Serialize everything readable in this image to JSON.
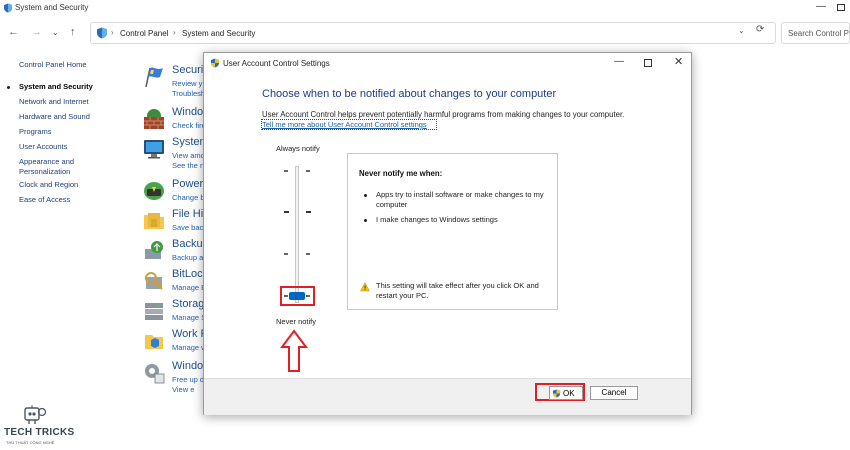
{
  "window": {
    "title": "System and Security"
  },
  "address": {
    "crumbs": [
      "Control Panel",
      "System and Security"
    ],
    "search_placeholder": "Search Control Panel"
  },
  "sidebar": {
    "items": [
      {
        "label": "Control Panel Home"
      },
      {
        "label": "System and Security",
        "current": true
      },
      {
        "label": "Network and Internet"
      },
      {
        "label": "Hardware and Sound"
      },
      {
        "label": "Programs"
      },
      {
        "label": "User Accounts"
      },
      {
        "label": "Appearance and"
      },
      {
        "label": "Personalization"
      },
      {
        "label": "Clock and Region"
      },
      {
        "label": "Ease of Access"
      }
    ]
  },
  "categories": [
    {
      "name": "Securit",
      "links": [
        "Review y",
        "Troublesh"
      ],
      "icon": "flag-icon"
    },
    {
      "name": "Window",
      "links": [
        "Check fire"
      ],
      "icon": "firewall-icon"
    },
    {
      "name": "System",
      "links": [
        "View amo",
        "See the n"
      ],
      "icon": "monitor-icon"
    },
    {
      "name": "Power O",
      "links": [
        "Change b"
      ],
      "icon": "power-icon"
    },
    {
      "name": "File His",
      "links": [
        "Save back"
      ],
      "icon": "folder-icon"
    },
    {
      "name": "Backup",
      "links": [
        "Backup a"
      ],
      "icon": "backup-icon"
    },
    {
      "name": "BitLock",
      "links": [
        "Manage B"
      ],
      "icon": "key-icon"
    },
    {
      "name": "Storage",
      "links": [
        "Manage S"
      ],
      "icon": "storage-icon"
    },
    {
      "name": "Work F",
      "links": [
        "Manage w"
      ],
      "icon": "work-folders-icon"
    },
    {
      "name": "Window",
      "links": [
        "Free up d",
        "View e"
      ],
      "icon": "tools-icon"
    }
  ],
  "dialog": {
    "title": "User Account Control Settings",
    "heading": "Choose when to be notified about changes to your computer",
    "description": "User Account Control helps prevent potentially harmful programs from making changes to your computer.",
    "learn_link": "Tell me more about User Account Control settings",
    "slider": {
      "top_label": "Always notify",
      "bottom_label": "Never notify",
      "level": 1,
      "levels": 4
    },
    "info": {
      "title": "Never notify me when:",
      "bullets": [
        "Apps try to install software or make changes to my computer",
        "I make changes to Windows settings"
      ],
      "warning": "This setting will take effect after you click OK and restart your PC."
    },
    "buttons": {
      "ok": "OK",
      "cancel": "Cancel"
    },
    "highlight_color": "#e31e24"
  },
  "watermark": {
    "name": "TECH TRICKS",
    "tagline": "THỦ THUẬT CÔNG NGHỆ"
  },
  "colors": {
    "accent": "#0067c0",
    "link": "#1e5fb0",
    "heading": "#1d3b8a"
  }
}
